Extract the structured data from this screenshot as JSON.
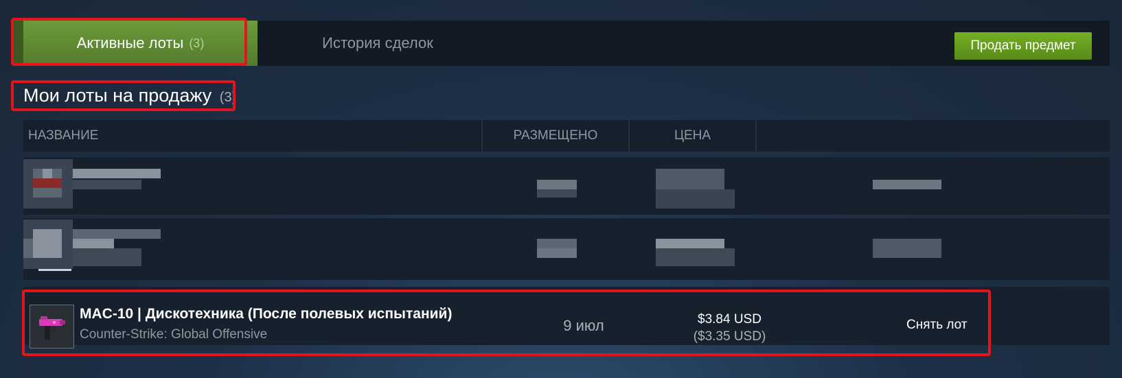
{
  "tabs": {
    "active_label": "Активные лоты",
    "active_count": "(3)",
    "history_label": "История сделок",
    "sell_button": "Продать предмет"
  },
  "section": {
    "title": "Мои лоты на продажу",
    "count": "(3)"
  },
  "table": {
    "headers": [
      "НАЗВАНИЕ",
      "РАЗМЕЩЕНО",
      "ЦЕНА"
    ]
  },
  "listing": {
    "icon": "mac10-weapon-icon",
    "name": "MAC-10 | Дискотехника (После полевых испытаний)",
    "game": "Counter-Strike: Global Offensive",
    "date": "9 июл",
    "price": "$3.84 USD",
    "price_without_fee": "($3.35 USD)",
    "remove_label": "Снять лот"
  },
  "colors": {
    "highlight": "#e3141b",
    "active_tab": "#5f8a34",
    "sell_button": "#6a9f1f",
    "background": "#1b2838"
  }
}
